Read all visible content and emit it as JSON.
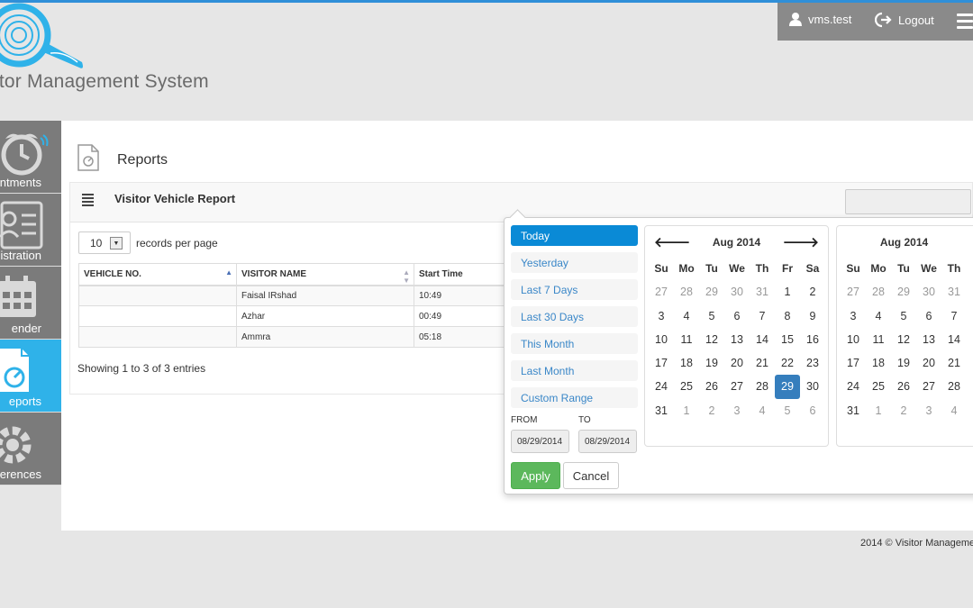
{
  "brand": {
    "name": "Visitor Management System",
    "visible_text": "itor Management System",
    "accent": "#2fb2e9"
  },
  "userbar": {
    "username": "vms.test",
    "logout_label": "Logout",
    "user_icon": "user-icon",
    "logout_icon": "logout-icon",
    "menu_icon": "hamburger-icon"
  },
  "sidenav": {
    "items": [
      {
        "label": "intments",
        "icon": "alarm-clock-icon",
        "active": false
      },
      {
        "label": "egistration",
        "icon": "id-card-icon",
        "active": false
      },
      {
        "label": "ender",
        "icon": "calendar-icon",
        "active": false
      },
      {
        "label": "eports",
        "icon": "report-icon",
        "active": true
      },
      {
        "label": "erences",
        "icon": "gear-icon",
        "active": false
      }
    ]
  },
  "page": {
    "title": "Reports",
    "panel_title": "Visitor Vehicle Report",
    "rpp_value": "10",
    "rpp_label": "records per page",
    "showing": "Showing 1 to 3 of 3 entries"
  },
  "table": {
    "columns": [
      "VEHICLE NO.",
      "VISITOR NAME",
      "Start Time"
    ],
    "rows": [
      [
        "",
        "Faisal IRshad",
        "10:49"
      ],
      [
        "",
        "Azhar",
        "00:49"
      ],
      [
        "",
        "Ammra",
        "05:18"
      ]
    ]
  },
  "picker": {
    "ranges": [
      "Today",
      "Yesterday",
      "Last 7 Days",
      "Last 30 Days",
      "This Month",
      "Last Month",
      "Custom Range"
    ],
    "active_range": "Today",
    "from_label": "FROM",
    "to_label": "TO",
    "from_value": "08/29/2014",
    "to_value": "08/29/2014",
    "apply_label": "Apply",
    "cancel_label": "Cancel",
    "days_of_week": [
      "Su",
      "Mo",
      "Tu",
      "We",
      "Th",
      "Fr",
      "Sa"
    ],
    "left_calendar": {
      "month": "Aug 2014",
      "weeks": [
        [
          "27",
          "28",
          "29",
          "30",
          "31",
          "1",
          "2"
        ],
        [
          "3",
          "4",
          "5",
          "6",
          "7",
          "8",
          "9"
        ],
        [
          "10",
          "11",
          "12",
          "13",
          "14",
          "15",
          "16"
        ],
        [
          "17",
          "18",
          "19",
          "20",
          "21",
          "22",
          "23"
        ],
        [
          "24",
          "25",
          "26",
          "27",
          "28",
          "29",
          "30"
        ],
        [
          "31",
          "1",
          "2",
          "3",
          "4",
          "5",
          "6"
        ]
      ],
      "selected": "29"
    },
    "right_calendar": {
      "month": "Aug 2014",
      "weeks": [
        [
          "27",
          "28",
          "29",
          "30",
          "31"
        ],
        [
          "3",
          "4",
          "5",
          "6",
          "7"
        ],
        [
          "10",
          "11",
          "12",
          "13",
          "14"
        ],
        [
          "17",
          "18",
          "19",
          "20",
          "21"
        ],
        [
          "24",
          "25",
          "26",
          "27",
          "28"
        ],
        [
          "31",
          "1",
          "2",
          "3",
          "4"
        ]
      ]
    },
    "selected_color": "#357ebd",
    "active_range_color": "#0a8ad6",
    "apply_color": "#5cb85c"
  },
  "footer": {
    "text": "2014 © Visitor Manageme"
  }
}
